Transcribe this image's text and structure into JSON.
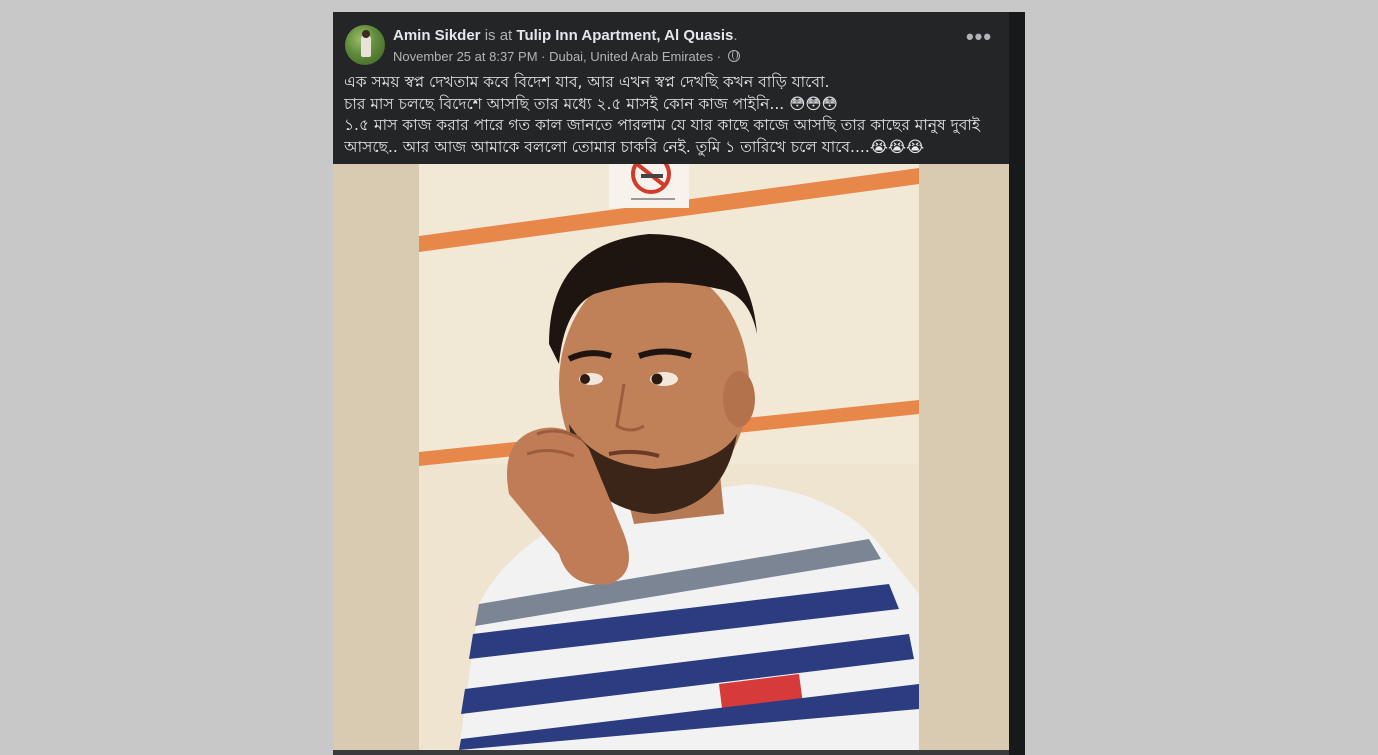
{
  "post": {
    "author": "Amin Sikder",
    "checkin_connector": "is at",
    "location": "Tulip Inn Apartment, Al Quasis",
    "location_suffix": ".",
    "timestamp": "November 25 at 8:37 PM",
    "place": "Dubai, United Arab Emirates",
    "separator": " · ",
    "privacy_icon": "globe-icon",
    "more_icon": "more-options-icon",
    "more_label": "•••",
    "text_lines": [
      "এক সময় স্বপ্ন দেখতাম  কবে বিদেশ যাব, আর এখন স্বপ্ন দেখছি  কখন বাড়ি যাবো.",
      "চার মাস চলছে বিদেশে আসছি তার মধ্যে ২.৫ মাসই কোন কাজ পাইনি... 😳😳😳",
      "১.৫ মাস কাজ করার পারে গত কাল জানতে পারলাম যে যার কাছে কাজে আসছি তার কাছের মানুষ দুবাই",
      "আসছে.. আর আজ আমাকে বললো তোমার চাকরি নেই. তুমি ১ তারিখে চলে যাবে....😭😭😭"
    ],
    "photo_icon": "person-photo"
  },
  "colors": {
    "page_background": "#c8c8c8",
    "card_background": "#242526",
    "primary_text": "#e4e6eb",
    "secondary_text": "#b0b3b8",
    "photo_backdrop": "#d8cbb1"
  }
}
